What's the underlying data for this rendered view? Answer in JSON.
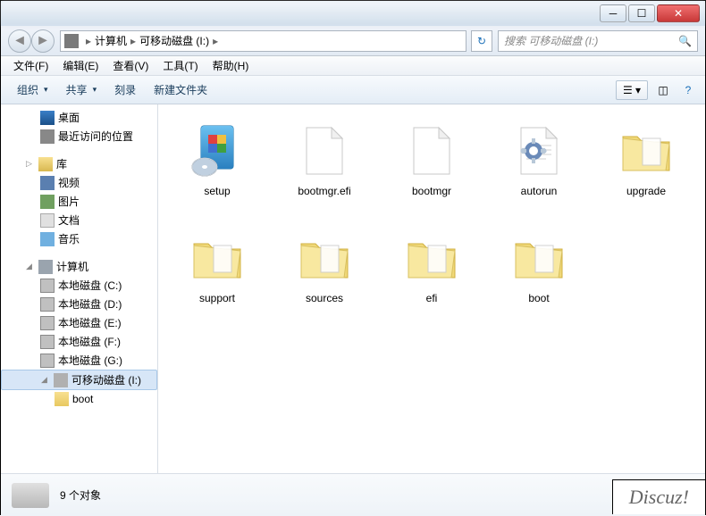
{
  "window": {
    "title": "可移动磁盘 (I:)"
  },
  "breadcrumb": {
    "part1": "计算机",
    "part2": "可移动磁盘 (I:)"
  },
  "search": {
    "placeholder": "搜索 可移动磁盘 (I:)"
  },
  "menu": {
    "file": "文件(F)",
    "edit": "编辑(E)",
    "view": "查看(V)",
    "tools": "工具(T)",
    "help": "帮助(H)"
  },
  "toolbar": {
    "organize": "组织",
    "share": "共享",
    "burn": "刻录",
    "newfolder": "新建文件夹"
  },
  "sidebar": {
    "desktop": "桌面",
    "recent": "最近访问的位置",
    "libraries": "库",
    "videos": "视频",
    "pictures": "图片",
    "documents": "文档",
    "music": "音乐",
    "computer": "计算机",
    "diskC": "本地磁盘 (C:)",
    "diskD": "本地磁盘 (D:)",
    "diskE": "本地磁盘 (E:)",
    "diskF": "本地磁盘 (F:)",
    "diskG": "本地磁盘 (G:)",
    "removableI": "可移动磁盘 (I:)",
    "boot": "boot"
  },
  "items": [
    {
      "name": "setup",
      "type": "exe"
    },
    {
      "name": "bootmgr.efi",
      "type": "file"
    },
    {
      "name": "bootmgr",
      "type": "file"
    },
    {
      "name": "autorun",
      "type": "inf"
    },
    {
      "name": "upgrade",
      "type": "folder"
    },
    {
      "name": "support",
      "type": "folder"
    },
    {
      "name": "sources",
      "type": "folder"
    },
    {
      "name": "efi",
      "type": "folder"
    },
    {
      "name": "boot",
      "type": "folder"
    }
  ],
  "status": {
    "count": "9 个对象"
  },
  "watermark": "Discuz!"
}
